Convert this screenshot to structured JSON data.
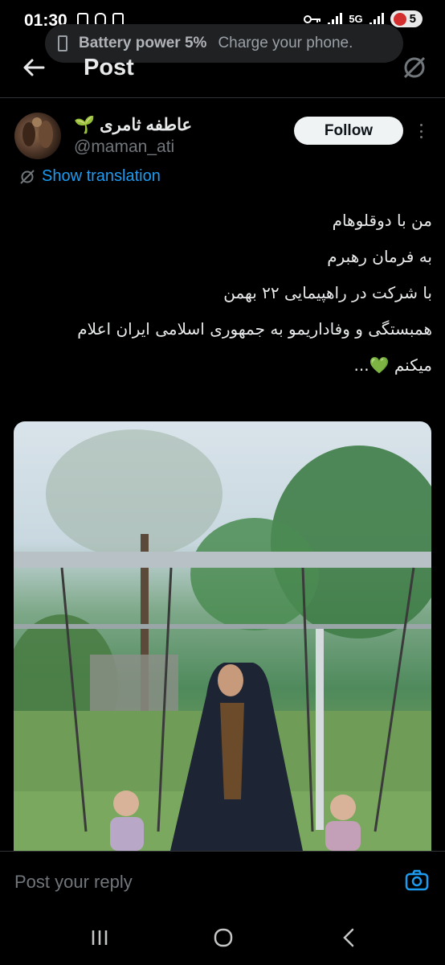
{
  "status_bar": {
    "time": "01:30",
    "network": "5G",
    "battery_level": "5",
    "battery_color": "#d32f2f"
  },
  "toast": {
    "title": "Battery power 5%",
    "message": "Charge your phone."
  },
  "header": {
    "title": "Post"
  },
  "post": {
    "display_name": "عاطفه ثامری",
    "name_emoji": "🌱",
    "username": "@maman_ati",
    "follow_label": "Follow",
    "show_translation_label": "Show translation",
    "text_lines": [
      "من با دوقلوهام",
      "به فرمان رهبرم",
      "با شرکت در راهپیمایی ۲۲ بهمن",
      "همبستگی و وفاداریمو به جمهوری اسلامی ایران اعلام",
      "میکنم 💚..."
    ]
  },
  "reply": {
    "placeholder": "Post your reply"
  },
  "colors": {
    "accent": "#1d9bf0",
    "background": "#000000",
    "text_primary": "#e7e9ea",
    "text_secondary": "#71767b",
    "follow_bg": "#eff3f4"
  },
  "icons": {
    "back": "arrow-left-icon",
    "translate": "translate-icon",
    "more": "more-vertical-icon",
    "camera": "camera-icon",
    "nav_recent": "recent-apps-icon",
    "nav_home": "home-circle-icon",
    "nav_back": "back-chevron-icon"
  }
}
